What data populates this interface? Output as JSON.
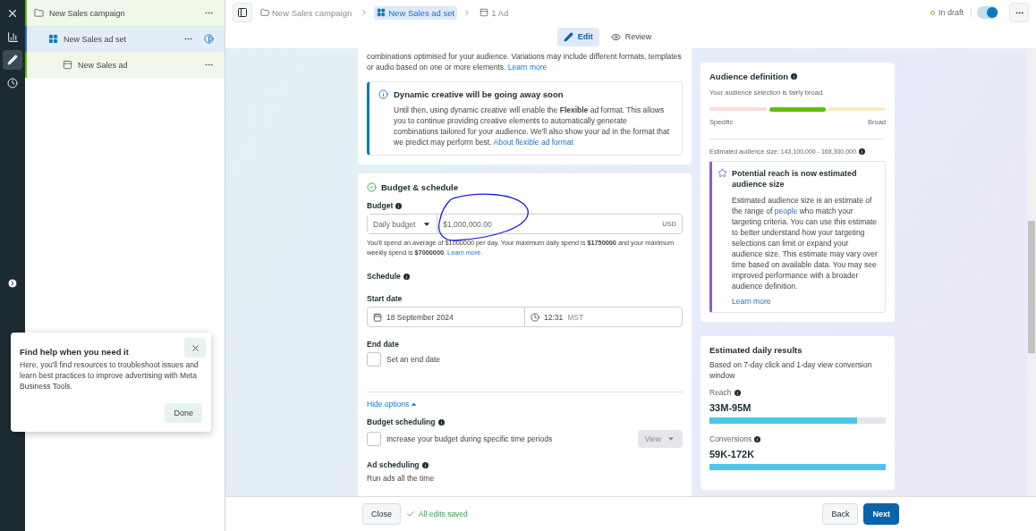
{
  "rail": [
    {
      "kind": "close",
      "selected": false
    },
    {
      "kind": "chart",
      "selected": false
    },
    {
      "kind": "edit",
      "selected": true
    },
    {
      "kind": "history",
      "selected": false
    },
    {
      "kind": "expand",
      "selected": false
    }
  ],
  "tree": [
    {
      "label": "New Sales campaign",
      "kind": "campaign",
      "selected": false,
      "children": [
        {
          "label": "New Sales ad set",
          "kind": "adset",
          "selected": true,
          "children": [
            {
              "label": "New Sales ad",
              "kind": "ad",
              "selected": false
            }
          ]
        }
      ]
    }
  ],
  "breadcrumb": [
    {
      "label": "New Sales campaign",
      "kind": "campaign",
      "selected": false
    },
    {
      "label": "New Sales ad set",
      "kind": "adset",
      "selected": true
    },
    {
      "label": "1 Ad",
      "kind": "ad",
      "selected": false
    }
  ],
  "status": {
    "label": "In draft",
    "toggle_on": true
  },
  "view_tabs": [
    {
      "label": "Edit",
      "kind": "edit",
      "selected": true
    },
    {
      "label": "Review",
      "kind": "review",
      "selected": false
    }
  ],
  "creative_note": {
    "text": "combinations optimised for your audience. Variations may include different formats, templates or audio based on one or more elements.",
    "link": "Learn more"
  },
  "notice": {
    "title": "Dynamic creative will be going away soon",
    "body": "Until then, using dynamic creative will enable the **Flexible** ad format. This allows you to continue providing creative elements to automatically generate combinations tailored for your audience. We'll also show your ad in the format that we predict may perform best.",
    "link": "About flexible ad format"
  },
  "budget": {
    "title": "Budget & schedule",
    "budget_label": "Budget",
    "budget_type": "Daily budget",
    "amount": "$1,000,000.00",
    "currency": "USD",
    "note": "You'll spend an average of $1000000 per day. Your maximum daily spend is **$1750000** and your maximum weekly spend is **$7000000**.",
    "note_link": "Learn more.",
    "schedule_label": "Schedule",
    "start_label": "Start date",
    "start_date": "18 September 2024",
    "start_time": "12:31",
    "timezone": "MST",
    "end_label": "End date",
    "end_checkbox": {
      "label": "Set an end date",
      "checked": false
    },
    "options_link": "Hide options",
    "budget_scheduling": {
      "label": "Budget scheduling",
      "checkbox_label": "Increase your budget during specific time periods",
      "checked": false,
      "button": "View"
    },
    "ad_scheduling": {
      "label": "Ad scheduling",
      "text": "Run ads all the time"
    }
  },
  "audience": {
    "title": "Audience definition",
    "summary": "Your audience selection is fairly broad.",
    "segments": [
      {
        "selected": false,
        "color": "#f9dcdc"
      },
      {
        "selected": true,
        "color": "#63be09"
      },
      {
        "selected": false,
        "color": "#fbecc6"
      }
    ],
    "scale_labels": [
      "Specific",
      "Broad"
    ],
    "size": "Estimated audience size: 143,100,000 - 168,300,000",
    "tip": {
      "title": "Potential reach is now estimated audience size",
      "body_start": "Estimated audience size is an estimate of the range of",
      "link": "people",
      "body_end": "who match your targeting criteria. You can use this estimate to better understand how your targeting selections can limit or expand your audience size. This estimate may vary over time based on available data. You may see improved performance with a broader audience definition.",
      "learn_more": "Learn more"
    }
  },
  "results": {
    "title": "Estimated daily results",
    "subtitle": "Based on 7-day click and 1-day view conversion window",
    "metrics": [
      {
        "label": "Reach",
        "value": "33M-95M",
        "level": 0.84
      },
      {
        "label": "Conversions",
        "value": "59K-172K",
        "level": 1.0
      }
    ]
  },
  "footer": {
    "close": "Close",
    "saved": "All edits saved",
    "back": "Back",
    "next": "Next"
  },
  "help": {
    "title": "Find help when you need it",
    "body": "Here, you'll find resources to troubleshoot issues and learn best practices to improve advertising with Meta Business Tools.",
    "done": "Done"
  }
}
